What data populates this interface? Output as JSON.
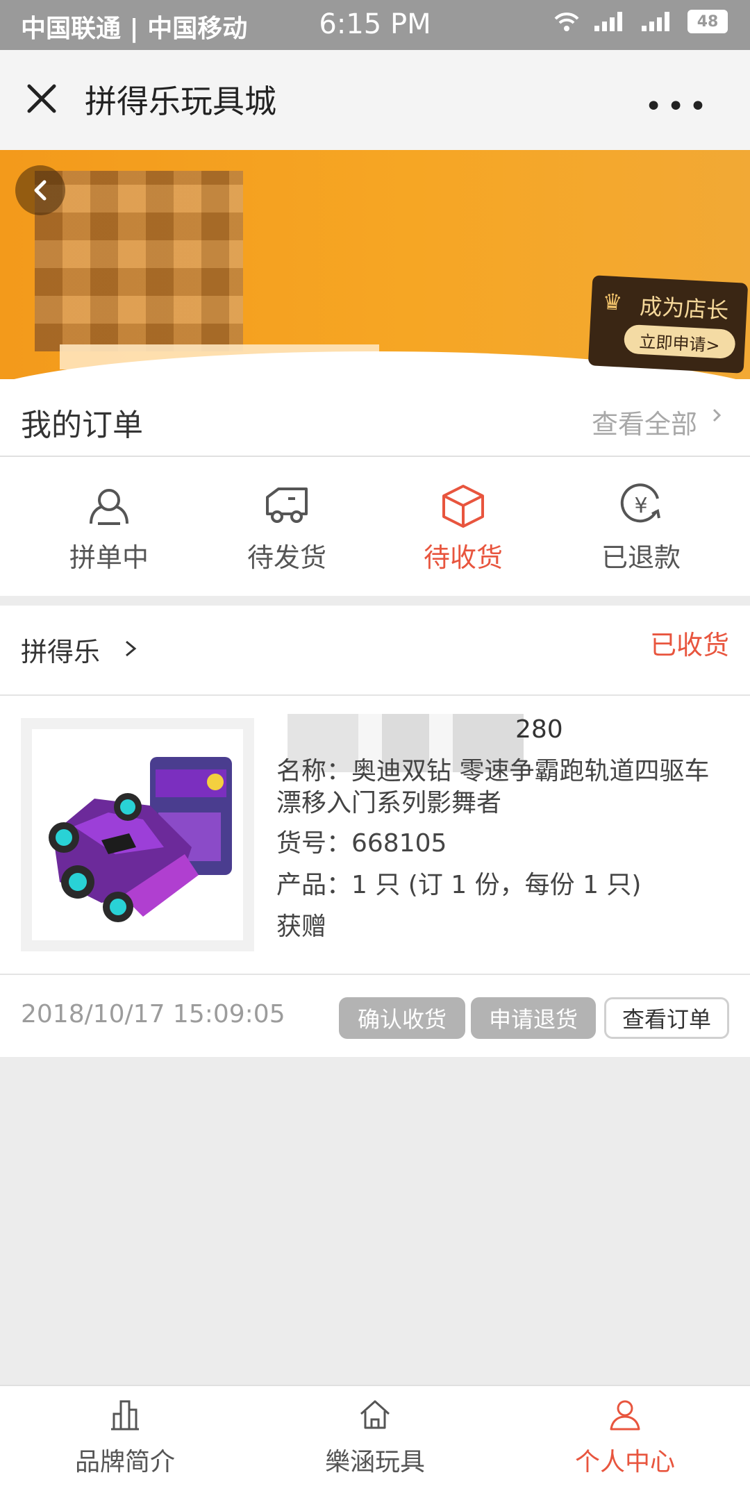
{
  "status_bar": {
    "carrier": "中国联通 | 中国移动",
    "time": "6:15 PM",
    "battery": "48"
  },
  "title_bar": {
    "title": "拼得乐玩具城"
  },
  "banner": {
    "shopkeeper_title": "成为店长",
    "shopkeeper_button": "立即申请>"
  },
  "my_orders": {
    "label": "我的订单",
    "view_all": "查看全部"
  },
  "order_tabs": [
    {
      "label": "拼单中",
      "icon": "group-icon"
    },
    {
      "label": "待发货",
      "icon": "truck-icon"
    },
    {
      "label": "待收货",
      "icon": "box-icon"
    },
    {
      "label": "已退款",
      "icon": "refund-icon"
    }
  ],
  "order": {
    "store": "拼得乐",
    "status": "已收货",
    "code_tail": "280",
    "name": "名称：奥迪双钻 零速争霸跑轨道四驱车 漂移入门系列影舞者",
    "number": "货号：668105",
    "quantity": "产品：1 只 (订 1 份，每份 1 只)",
    "gift": "获赠",
    "time": "2018/10/17 15:09:05",
    "buttons": [
      "确认收货",
      "申请退货",
      "查看订单"
    ]
  },
  "bottom_nav": [
    {
      "label": "品牌简介",
      "icon": "building-icon"
    },
    {
      "label": "樂涵玩具",
      "icon": "home-icon"
    },
    {
      "label": "个人中心",
      "icon": "person-icon"
    }
  ],
  "colors": {
    "accent": "#e8553e",
    "banner": "#f39a1b"
  }
}
